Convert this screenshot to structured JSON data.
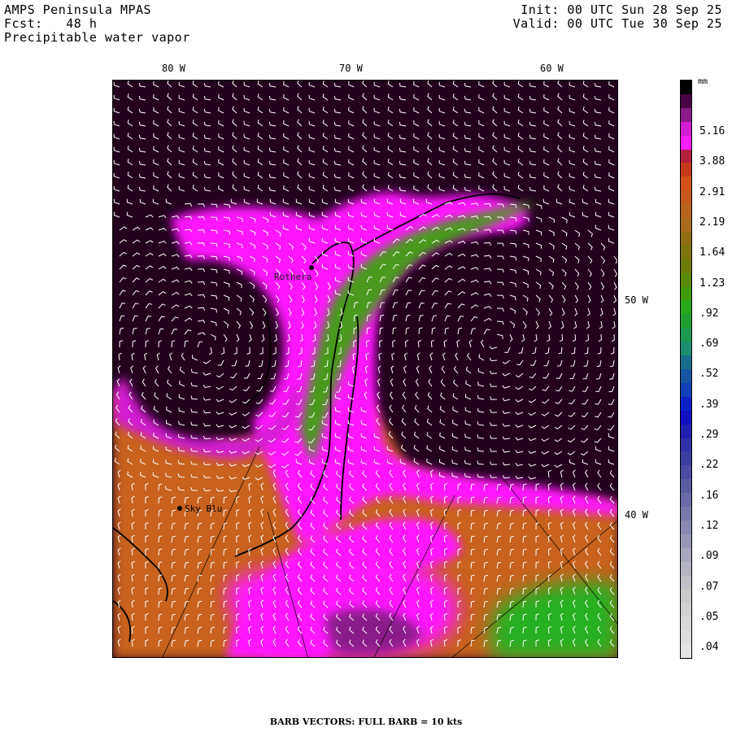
{
  "header": {
    "title": "AMPS Peninsula MPAS",
    "forecast": "Fcst:   48 h",
    "field": "Precipitable water vapor",
    "init": "Init: 00 UTC Sun 28 Sep 25",
    "valid": "Valid: 00 UTC Tue 30 Sep 25"
  },
  "axes": {
    "lon_labels": [
      "80 W",
      "70 W",
      "60 W"
    ],
    "lat_labels": [
      "50 W",
      "40 W"
    ]
  },
  "stations": [
    {
      "name": "Rothera"
    },
    {
      "name": "Sky Blu"
    }
  ],
  "colorbar": {
    "unit": "mm",
    "labels": [
      "5.16",
      "3.88",
      "2.91",
      "2.19",
      "1.64",
      "1.23",
      ".92",
      ".69",
      ".52",
      ".39",
      ".29",
      ".22",
      ".16",
      ".12",
      ".09",
      ".07",
      ".05",
      ".04"
    ],
    "colors": [
      "#000000",
      "#4a0046",
      "#8a1a8a",
      "#d21ed2",
      "#ff1eff",
      "#b2203a",
      "#c43a18",
      "#d15014",
      "#c4581a",
      "#b8651c",
      "#a86a18",
      "#8e6e10",
      "#7e7408",
      "#6e7c06",
      "#5a8a04",
      "#3f9a06",
      "#28a818",
      "#1ea030",
      "#1c9a52",
      "#1a8e70",
      "#166e8a",
      "#1456a2",
      "#1040b8",
      "#0c22c6",
      "#1010c0",
      "#2020b0",
      "#3030a8",
      "#3e3ea2",
      "#4c4ca0",
      "#5c5ca2",
      "#6a6aa6",
      "#7878aa",
      "#8888b0",
      "#9898b6",
      "#a8a8bc",
      "#b4b4c2",
      "#c0c0c6",
      "#cacaca",
      "#d2d2d2",
      "#d8d8d8",
      "#dedede",
      "#e4e4e4"
    ]
  },
  "footer": "BARB VECTORS:  FULL BARB = 10 kts",
  "palette": {
    "background": "#2a0026",
    "magenta": "#ff14ff",
    "orange": "#c8621a",
    "green": "#28b020",
    "purple": "#8a1a8a",
    "barb": "#ffffff",
    "coast": "#000000"
  }
}
